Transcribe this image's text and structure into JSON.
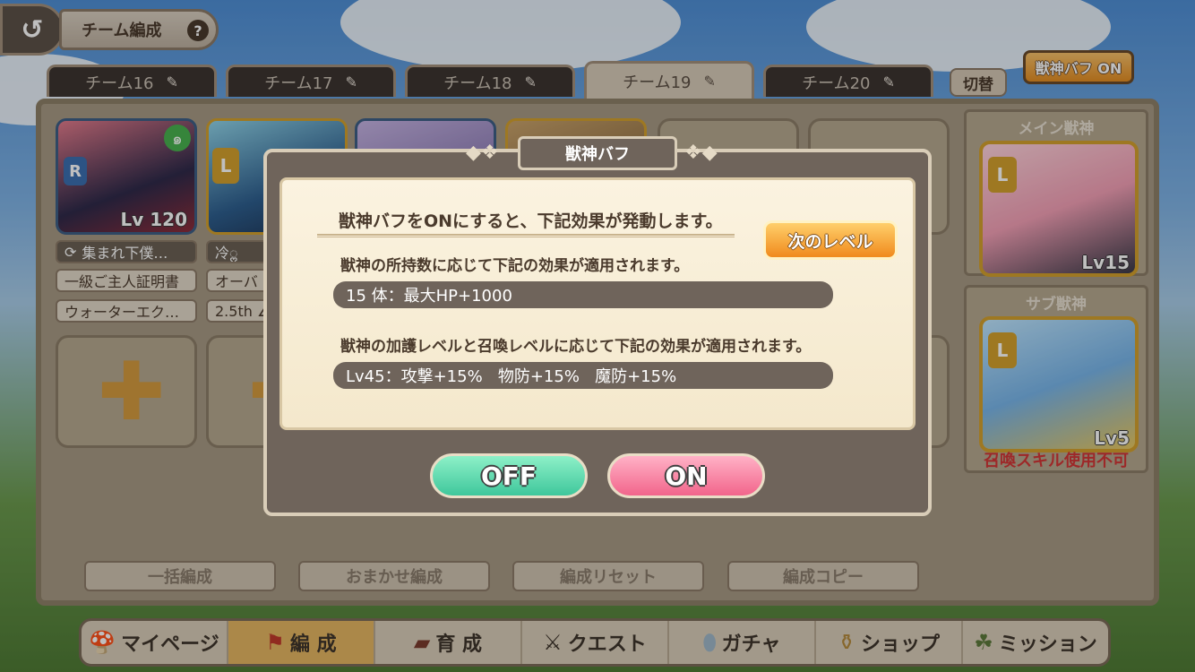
{
  "header": {
    "back_icon": "back-arrow-icon",
    "title": "チーム編成",
    "help_label": "?"
  },
  "tabs": [
    {
      "label": "チーム16",
      "active": false
    },
    {
      "label": "チーム17",
      "active": false
    },
    {
      "label": "チーム18",
      "active": false
    },
    {
      "label": "チーム19",
      "active": true
    },
    {
      "label": "チーム20",
      "active": false
    }
  ],
  "switch_label": "切替",
  "buff_toggle_label": "獣神バフ ON",
  "team": {
    "card1": {
      "rarity": "R",
      "level": "Lv 120"
    },
    "card1_pills": [
      "集まれ下僕…",
      "一級ご主人証明書",
      "ウォーターエク…"
    ],
    "card2_pills": [
      "冷ॢ",
      "オーバ",
      "2.5th ∠"
    ]
  },
  "side": {
    "main_title": "メイン獣神",
    "main_level": "Lv15",
    "sub_title": "サブ獣神",
    "sub_level": "Lv5",
    "sub_warning": "召喚スキル使用不可"
  },
  "bottom_buttons": [
    "一括編成",
    "おまかせ編成",
    "編成リセット",
    "編成コピー"
  ],
  "nav": [
    {
      "label": "マイページ",
      "icon": "mushroom-house-icon",
      "active": false
    },
    {
      "label": "編 成",
      "icon": "flag-icon",
      "active": true
    },
    {
      "label": "育 成",
      "icon": "book-icon",
      "active": false
    },
    {
      "label": "クエスト",
      "icon": "crossed-swords-icon",
      "active": false
    },
    {
      "label": "ガチャ",
      "icon": "egg-icon",
      "active": false
    },
    {
      "label": "ショップ",
      "icon": "potion-bag-icon",
      "active": false
    },
    {
      "label": "ミッション",
      "icon": "turtle-icon",
      "active": false
    }
  ],
  "dialog": {
    "title": "獣神バフ",
    "headline": "獣神バフをONにすると、下記効果が発動します。",
    "next_level_label": "次のレベル",
    "section1": "獣神の所持数に応じて下記の効果が適用されます。",
    "effect1": "15 体：最大HP+1000",
    "section2": "獣神の加護レベルと召喚レベルに応じて下記の効果が適用されます。",
    "effect2": "Lv45：攻撃+15%   物防+15%   魔防+15%",
    "off_label": "OFF",
    "on_label": "ON"
  },
  "colors": {
    "accent_orange": "#f08a1c",
    "off_green": "#3fc79c",
    "on_pink": "#f2658b",
    "warning_red": "#d23636"
  }
}
